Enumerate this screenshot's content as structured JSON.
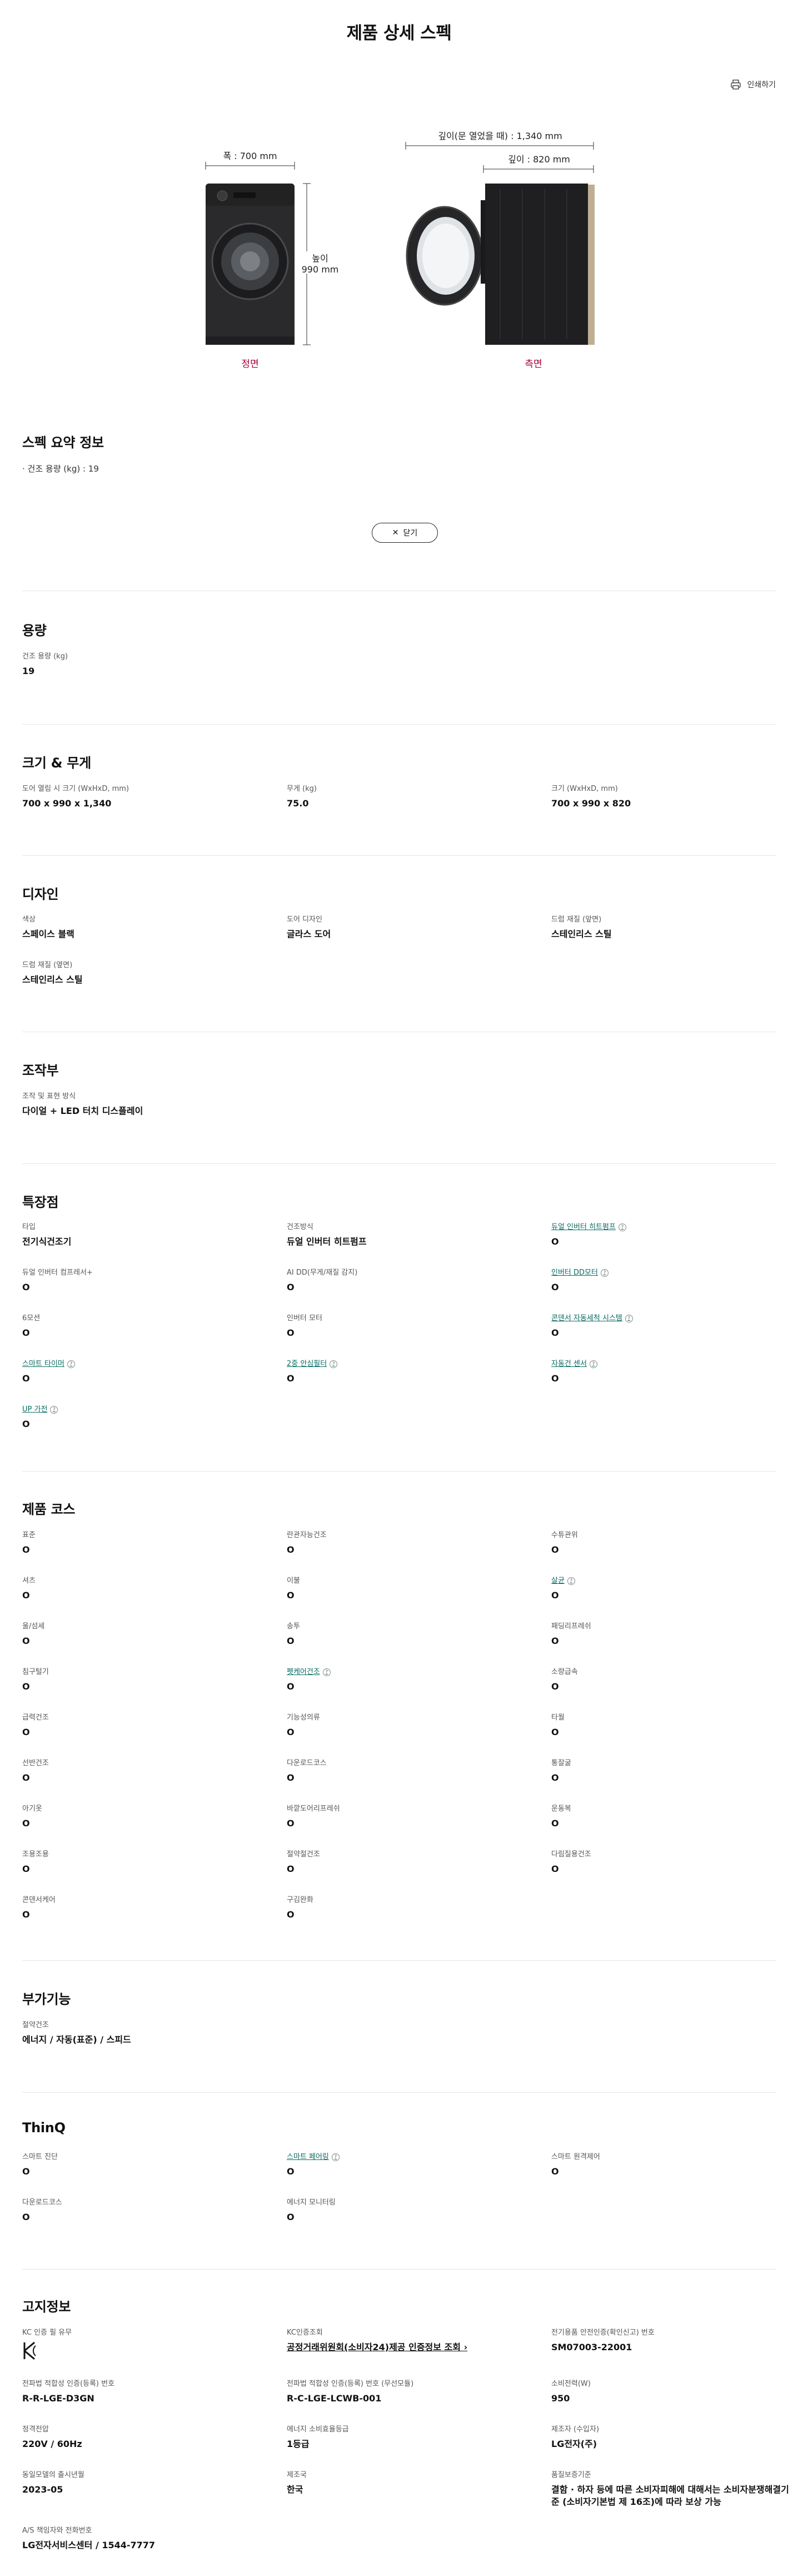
{
  "page_title": "제품 상세 스펙",
  "print_label": "인쇄하기",
  "diagram": {
    "front_width": "폭 : 700 mm",
    "height_label": "높이",
    "height_value": "990 mm",
    "front_caption": "정면",
    "depth_open": "깊이(문 열었을 때) : 1,340 mm",
    "depth": "깊이 : 820 mm",
    "side_caption": "측면"
  },
  "summary": {
    "title": "스펙 요약 정보",
    "item": "건조 용량 (kg) : 19",
    "close_label": "닫기"
  },
  "sections": {
    "capacity": {
      "title": "용량",
      "items": [
        {
          "label": "건조 용량 (kg)",
          "value": "19"
        }
      ]
    },
    "size": {
      "title": "크기 & 무게",
      "items": [
        {
          "label": "도어 열림 시 크기 (WxHxD, mm)",
          "value": "700 x 990 x 1,340"
        },
        {
          "label": "무게 (kg)",
          "value": "75.0"
        },
        {
          "label": "크기 (WxHxD, mm)",
          "value": "700 x 990 x 820"
        }
      ]
    },
    "design": {
      "title": "디자인",
      "items": [
        {
          "label": "색상",
          "value": "스페이스 블랙"
        },
        {
          "label": "도어 디자인",
          "value": "글라스 도어"
        },
        {
          "label": "드럼 재질 (앞면)",
          "value": "스테인리스 스틸"
        },
        {
          "label": "드럼 재질 (옆면)",
          "value": "스테인리스 스틸"
        }
      ]
    },
    "control": {
      "title": "조작부",
      "items": [
        {
          "label": "조작 및 표현 방식",
          "value": "다이얼 + LED 터치 디스플레이"
        }
      ]
    },
    "features": {
      "title": "특장점",
      "items": [
        {
          "label": "타입",
          "value": "전기식건조기"
        },
        {
          "label": "건조방식",
          "value": "듀얼 인버터 히트펌프"
        },
        {
          "label": "듀얼 인버터 히트펌프",
          "value": "O"
        },
        {
          "label": "듀얼 인버터 컴프레서+",
          "value": "O"
        },
        {
          "label": "AI DD(무게/재질 감지)",
          "value": "O"
        },
        {
          "label": "인버터 DD모터",
          "value": "O"
        },
        {
          "label": "6모션",
          "value": "O"
        },
        {
          "label": "인버터 모터",
          "value": "O"
        },
        {
          "label": "콘덴서 자동세척 시스템",
          "value": "O"
        },
        {
          "label": "스마트 타이머",
          "value": "O"
        },
        {
          "label": "2중 안심필터",
          "value": "O"
        },
        {
          "label": "자동건 센서",
          "value": "O"
        },
        {
          "label": "UP 가전",
          "value": "O"
        }
      ]
    },
    "courses": {
      "title": "제품 코스",
      "items": [
        {
          "label": "표준",
          "value": "O"
        },
        {
          "label": "란관자능건조",
          "value": "O"
        },
        {
          "label": "수튜관위",
          "value": "O"
        },
        {
          "label": "셔츠",
          "value": "O"
        },
        {
          "label": "이불",
          "value": "O"
        },
        {
          "label": "살균",
          "value": "O"
        },
        {
          "label": "울/섬세",
          "value": "O"
        },
        {
          "label": "송투",
          "value": "O"
        },
        {
          "label": "패딩리프레쉬",
          "value": "O"
        },
        {
          "label": "침구털기",
          "value": "O"
        },
        {
          "label": "펫케어건조",
          "value": "O"
        },
        {
          "label": "소량급속",
          "value": "O"
        },
        {
          "label": "급력건조",
          "value": "O"
        },
        {
          "label": "기능성의류",
          "value": "O"
        },
        {
          "label": "타월",
          "value": "O"
        },
        {
          "label": "선반건조",
          "value": "O"
        },
        {
          "label": "다운로드코스",
          "value": "O"
        },
        {
          "label": "통잘굴",
          "value": "O"
        },
        {
          "label": "아기옷",
          "value": "O"
        },
        {
          "label": "바깥도어리프레쉬",
          "value": "O"
        },
        {
          "label": "운동복",
          "value": "O"
        },
        {
          "label": "조용조용",
          "value": "O"
        },
        {
          "label": "절약절건조",
          "value": "O"
        },
        {
          "label": "다림질용건조",
          "value": "O"
        },
        {
          "label": "콘덴서케어",
          "value": "O"
        },
        {
          "label": "구김완화",
          "value": "O"
        }
      ]
    },
    "extra": {
      "title": "부가기능",
      "items": [
        {
          "label": "절약건조",
          "value": "에너지 / 자동(표준) / 스피드"
        }
      ]
    },
    "thinq": {
      "title": "ThinQ",
      "items": [
        {
          "label": "스마트 진단",
          "value": "O"
        },
        {
          "label": "스마트 페어링",
          "value": "O"
        },
        {
          "label": "스마트 원격제어",
          "value": "O"
        },
        {
          "label": "다운로드코스",
          "value": "O"
        },
        {
          "label": "에너지 모니터링",
          "value": "O"
        }
      ]
    },
    "notice": {
      "title": "고지정보",
      "items": [
        {
          "label": "KC 인증 필 유무",
          "value": ""
        },
        {
          "label": "KC인증조회",
          "value": "공정거래위원회(소비자24)제공 인증정보 조회"
        },
        {
          "label": "전기용품 안전인증(확인신고) 번호",
          "value": "SM07003-22001"
        },
        {
          "label": "전파법 적합성 인증(등록) 번호",
          "value": "R-R-LGE-D3GN"
        },
        {
          "label": "전파법 적합성 인증(등록) 번호 (무선모듈)",
          "value": "R-C-LGE-LCWB-001"
        },
        {
          "label": "소비전력(W)",
          "value": "950"
        },
        {
          "label": "정격전압",
          "value": "220V / 60Hz"
        },
        {
          "label": "에너지 소비효율등급",
          "value": "1등급"
        },
        {
          "label": "제조자 (수입자)",
          "value": "LG전자(주)"
        },
        {
          "label": "동일모델의 출시년월",
          "value": "2023-05"
        },
        {
          "label": "제조국",
          "value": "한국"
        },
        {
          "label": "품질보증기준",
          "value": "결함 · 하자 등에 따른 소비자피해에 대해서는 소비자분쟁해결기준 (소비자기본법 제 16조)에 따라 보상 가능"
        },
        {
          "label": "A/S 책임자와 전화번호",
          "value": "LG전자서비스센터 / 1544-7777"
        }
      ]
    }
  },
  "colors": {
    "accent_red": "#a50034",
    "link_teal": "#0a6b63"
  }
}
